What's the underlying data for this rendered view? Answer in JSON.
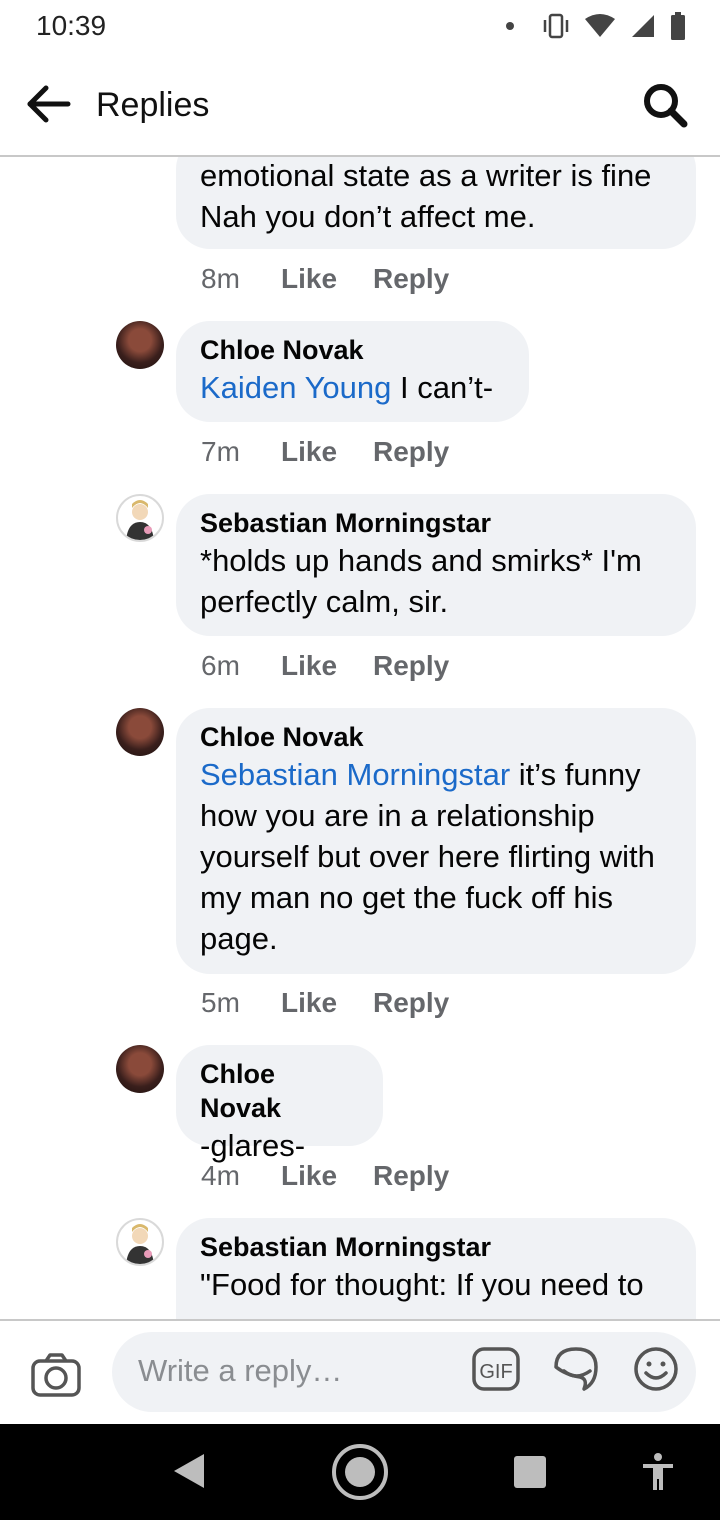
{
  "status_bar": {
    "time": "10:39"
  },
  "app_bar": {
    "title": "Replies"
  },
  "comments": [
    {
      "author": "",
      "mention": "",
      "text": "emotional state as a writer is fine\nNah you don’t affect me.",
      "age": "8m"
    },
    {
      "author": "Chloe Novak",
      "mention": "Kaiden Young",
      "text": " I can’t-",
      "age": "7m"
    },
    {
      "author": "Sebastian Morningstar",
      "mention": "",
      "text": "*holds up hands and smirks* I'm perfectly calm, sir.",
      "age": "6m"
    },
    {
      "author": "Chloe Novak",
      "mention": "Sebastian Morningstar",
      "text": " it’s funny how you are in a relationship yourself but over here flirting with my man no get the fuck off his page.",
      "age": "5m"
    },
    {
      "author": "Chloe Novak",
      "mention": "",
      "text": "-glares-",
      "age": "4m"
    },
    {
      "author": "Sebastian Morningstar",
      "mention": "",
      "text": "\"Food for thought: If you need to",
      "age": ""
    }
  ],
  "actions": {
    "like": "Like",
    "reply": "Reply"
  },
  "composer": {
    "placeholder": "Write a reply…",
    "gif_label": "GIF"
  },
  "colors": {
    "mention": "#1b6ac9",
    "bubble": "#f0f2f5",
    "meta": "#65676b"
  }
}
